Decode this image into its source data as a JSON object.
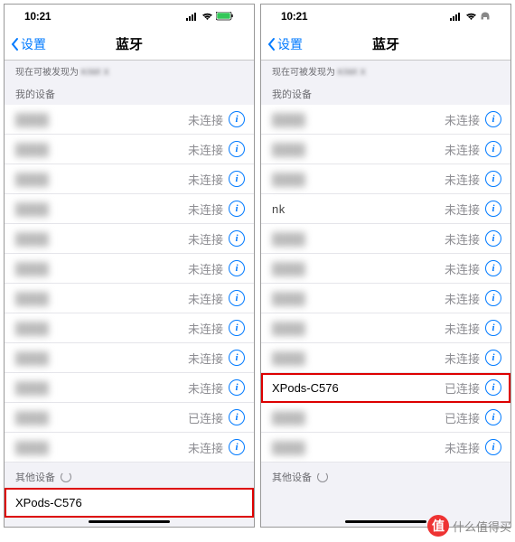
{
  "status": {
    "time": "10:21",
    "signal_bars": 4
  },
  "nav": {
    "back_label": "设置",
    "title": "蓝牙"
  },
  "discoverable_prefix": "现在可被发现为",
  "discoverable_name_fragment": "KIWI X",
  "sections": {
    "my_devices": "我的设备",
    "other_devices": "其他设备"
  },
  "status_text": {
    "not_connected": "未连接",
    "connected": "已连接"
  },
  "left_screen": {
    "devices": [
      {
        "name": "",
        "status": "未连接",
        "blur": true
      },
      {
        "name": "",
        "status": "未连接",
        "blur": true
      },
      {
        "name": "",
        "status": "未连接",
        "blur": true
      },
      {
        "name": "",
        "status": "未连接",
        "blur": true
      },
      {
        "name": "",
        "status": "未连接",
        "blur": true
      },
      {
        "name": "",
        "status": "未连接",
        "blur": true
      },
      {
        "name": "",
        "status": "未连接",
        "blur": true
      },
      {
        "name": "",
        "status": "未连接",
        "blur": true
      },
      {
        "name": "",
        "status": "未连接",
        "blur": true
      },
      {
        "name": "",
        "status": "未连接",
        "blur": true
      },
      {
        "name": "",
        "status": "已连接",
        "blur": true
      },
      {
        "name": "",
        "status": "未连接",
        "blur": true
      }
    ],
    "other": [
      {
        "name": "XPods-C576",
        "highlight": true
      }
    ]
  },
  "right_screen": {
    "devices": [
      {
        "name": "",
        "status": "未连接",
        "blur": true
      },
      {
        "name": "",
        "status": "未连接",
        "blur": true
      },
      {
        "name": "",
        "status": "未连接",
        "blur": true
      },
      {
        "name": "nk",
        "status": "未连接",
        "partial": true
      },
      {
        "name": "",
        "status": "未连接",
        "blur": true
      },
      {
        "name": "",
        "status": "未连接",
        "blur": true
      },
      {
        "name": "",
        "status": "未连接",
        "blur": true
      },
      {
        "name": "",
        "status": "未连接",
        "blur": true
      },
      {
        "name": "",
        "status": "未连接",
        "blur": true
      },
      {
        "name": "XPods-C576",
        "status": "已连接",
        "highlight": true
      },
      {
        "name": "",
        "status": "已连接",
        "blur": true
      },
      {
        "name": "",
        "status": "未连接",
        "blur": true
      }
    ]
  },
  "watermark": {
    "badge": "值",
    "text": "什么值得买"
  }
}
